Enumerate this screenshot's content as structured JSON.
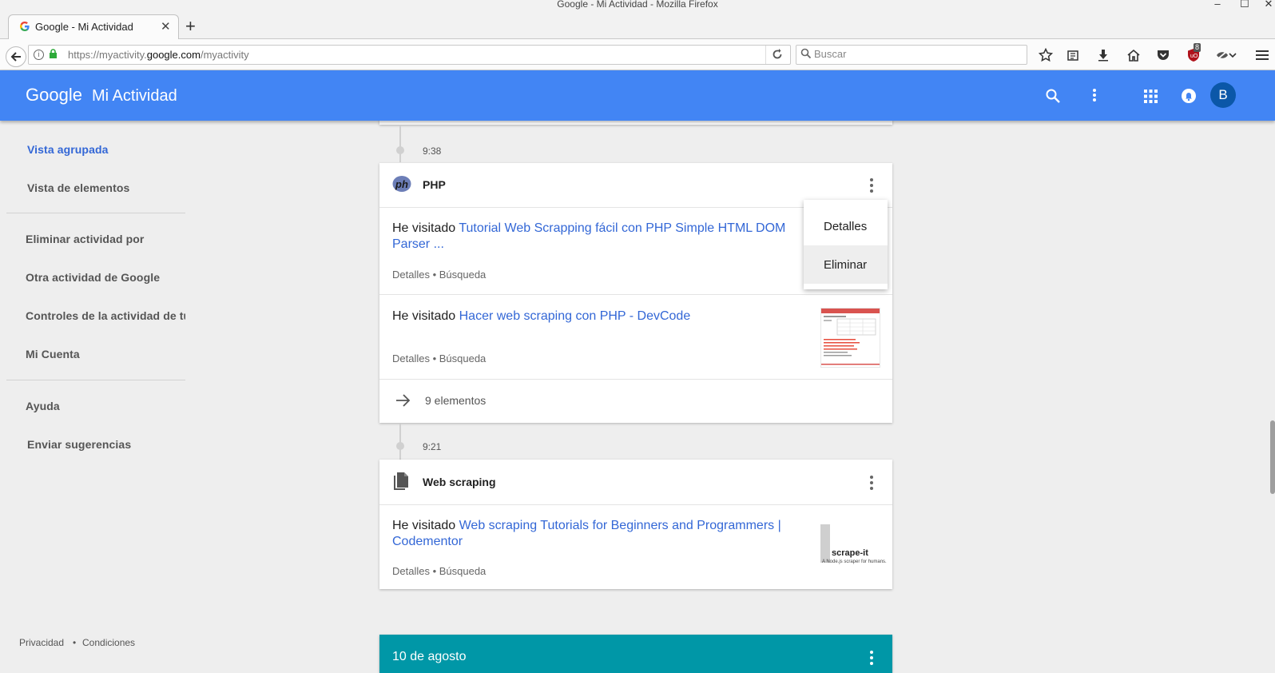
{
  "window": {
    "title": "Google - Mi Actividad - Mozilla Firefox"
  },
  "browser": {
    "tab_title": "Google - Mi Actividad",
    "url_prefix": "https://myactivity.",
    "url_domain": "google.com",
    "url_path": "/myactivity",
    "search_placeholder": "Buscar",
    "ublock_count": "8"
  },
  "header": {
    "logo": "Google",
    "product": "Mi Actividad",
    "avatar_letter": "B",
    "color": "#4285f4"
  },
  "sidebar": {
    "view_items": [
      {
        "label": "Vista agrupada"
      },
      {
        "label": "Vista de elementos"
      }
    ],
    "section_items": [
      {
        "label": "Eliminar actividad por"
      },
      {
        "label": "Otra actividad de Google"
      },
      {
        "label": "Controles de la actividad de tu"
      },
      {
        "label": "Mi Cuenta"
      }
    ],
    "help_items": [
      {
        "label": "Ayuda"
      },
      {
        "label": "Enviar sugerencias"
      }
    ],
    "footer": {
      "privacy": "Privacidad",
      "separator": "•",
      "terms": "Condiciones"
    }
  },
  "timeline": {
    "groups": [
      {
        "time": "9:38",
        "title": "PHP",
        "icon": "php-icon",
        "items": [
          {
            "prefix": "He visitado",
            "link": "Tutorial Web Scrapping fácil con PHP Simple HTML DOM Parser ...",
            "meta": "Detalles • Búsqueda"
          },
          {
            "prefix": "He visitado",
            "link": "Hacer web scraping con PHP - DevCode",
            "meta": "Detalles • Búsqueda"
          }
        ],
        "more_label": "9 elementos"
      },
      {
        "time": "9:21",
        "title": "Web scraping",
        "icon": "document-icon",
        "items": [
          {
            "prefix": "He visitado",
            "link": "Web scraping Tutorials for Beginners and Programmers | Codementor",
            "meta": "Detalles • Búsqueda",
            "thumb_text": "scrape-it",
            "thumb_sub": "A Node.js scraper for humans."
          }
        ]
      }
    ],
    "next_date": "10 de agosto",
    "date_color": "#0097a7"
  },
  "context_menu": {
    "items": [
      "Detalles",
      "Eliminar"
    ],
    "highlighted": "Eliminar"
  },
  "colors": {
    "link": "#3367d6",
    "active_nav": "#3367d6"
  }
}
